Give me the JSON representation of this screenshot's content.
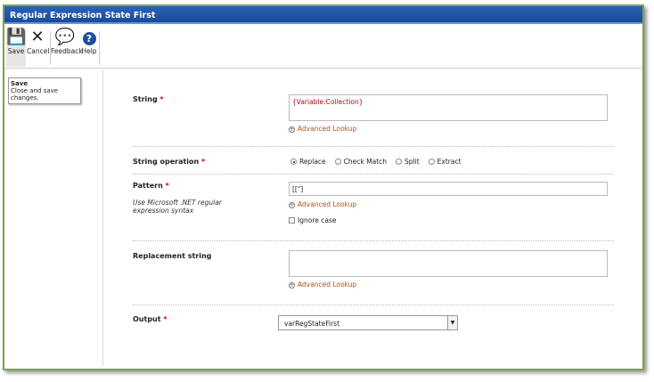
{
  "title": "Regular Expression State First",
  "toolbar": {
    "save": "Save",
    "cancel": "Cancel",
    "feedback": "Feedback",
    "help": "Help"
  },
  "tooltip": {
    "title": "Save",
    "text": "Close and save changes."
  },
  "form": {
    "string_label": "String",
    "string_value": "{Variable:Collection}",
    "advanced_lookup": "Advanced Lookup",
    "operation_label": "String operation",
    "operations": [
      "Replace",
      "Check Match",
      "Split",
      "Extract"
    ],
    "selected_operation": "Replace",
    "pattern_label": "Pattern",
    "pattern_hint": "Use Microsoft .NET regular expression syntax",
    "pattern_value": "[[\"]",
    "ignore_case": "Ignore case",
    "ignore_case_checked": false,
    "replacement_label": "Replacement string",
    "replacement_value": "",
    "output_label": "Output",
    "output_value": "varRegStateFirst",
    "required_mark": "*"
  }
}
